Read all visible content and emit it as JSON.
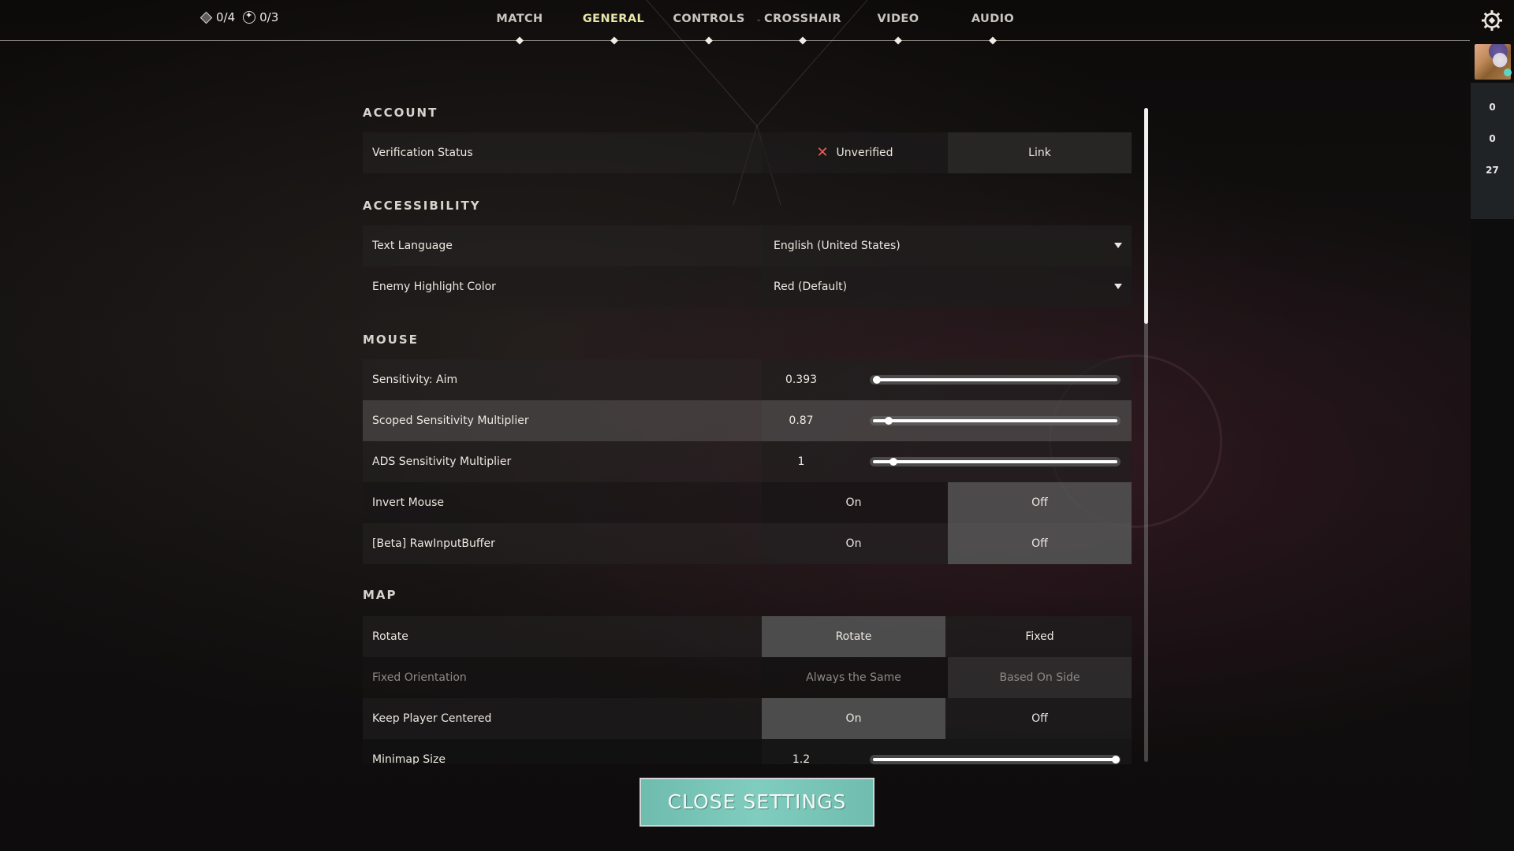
{
  "topbar": {
    "currency": [
      {
        "icon": "radianite-diamond-icon",
        "value": "0/4"
      },
      {
        "icon": "kingdom-credit-icon",
        "value": "0/3"
      }
    ],
    "tabs": [
      {
        "label": "MATCH",
        "active": false
      },
      {
        "label": "GENERAL",
        "active": true
      },
      {
        "label": "CONTROLS",
        "active": false
      },
      {
        "label": "CROSSHAIR",
        "active": false
      },
      {
        "label": "VIDEO",
        "active": false
      },
      {
        "label": "AUDIO",
        "active": false
      }
    ],
    "separator_icon": "⌄",
    "settings_icon": "gear-icon"
  },
  "side_panel": {
    "avatar_status_color": "#5fd6c1",
    "counts": [
      "0",
      "0",
      "27"
    ]
  },
  "sections": {
    "account": {
      "title": "ACCOUNT",
      "verification": {
        "label": "Verification Status",
        "status": "Unverified",
        "status_icon": "✕",
        "action": "Link"
      }
    },
    "accessibility": {
      "title": "ACCESSIBILITY",
      "text_language": {
        "label": "Text Language",
        "value": "English (United States)"
      },
      "enemy_highlight": {
        "label": "Enemy Highlight Color",
        "value": "Red (Default)"
      }
    },
    "mouse": {
      "title": "MOUSE",
      "sensitivity_aim": {
        "label": "Sensitivity: Aim",
        "value": "0.393",
        "fraction": 0.01
      },
      "scoped_multiplier": {
        "label": "Scoped Sensitivity Multiplier",
        "value": "0.87",
        "fraction": 0.06
      },
      "ads_multiplier": {
        "label": "ADS Sensitivity Multiplier",
        "value": "1",
        "fraction": 0.08
      },
      "invert_mouse": {
        "label": "Invert Mouse",
        "options": [
          "On",
          "Off"
        ],
        "selected": "Off"
      },
      "raw_input_buffer": {
        "label": "[Beta] RawInputBuffer",
        "options": [
          "On",
          "Off"
        ],
        "selected": "Off"
      }
    },
    "map": {
      "title": "MAP",
      "rotate": {
        "label": "Rotate",
        "options": [
          "Rotate",
          "Fixed"
        ],
        "selected": "Rotate"
      },
      "fixed_orientation": {
        "label": "Fixed Orientation",
        "options": [
          "Always the Same",
          "Based On Side"
        ],
        "selected": "Based On Side",
        "disabled": true
      },
      "keep_player_centered": {
        "label": "Keep Player Centered",
        "options": [
          "On",
          "Off"
        ],
        "selected": "On"
      },
      "minimap_size": {
        "label": "Minimap Size",
        "value": "1.2",
        "fraction": 1.0
      }
    }
  },
  "scroll_fraction": 0.33,
  "close_button": {
    "label": "CLOSE SETTINGS"
  },
  "colors": {
    "accent_tab": "#e8e6a8",
    "close_button": "#7fccbe",
    "error": "#ef5a5a"
  }
}
